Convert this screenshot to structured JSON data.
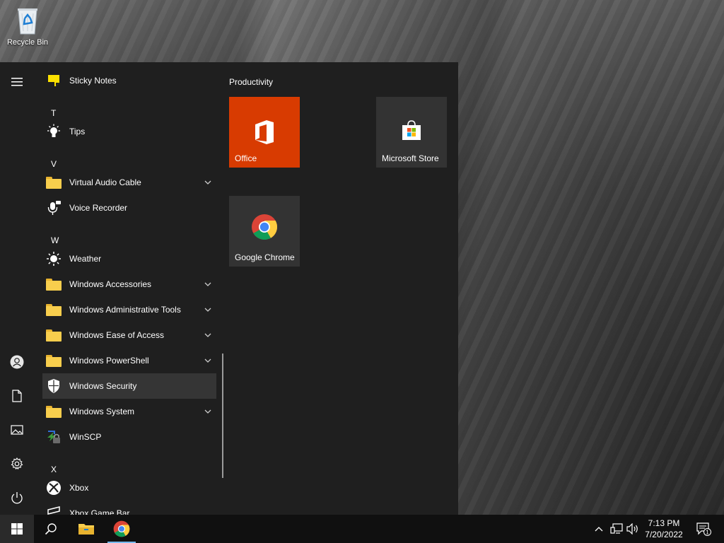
{
  "desktop": {
    "icons": [
      {
        "label": "Recycle Bin",
        "icon": "recycle-bin-icon"
      }
    ]
  },
  "start_menu": {
    "rail": [
      {
        "name": "hamburger-menu",
        "icon": "menu-icon"
      },
      {
        "name": "user-account",
        "icon": "user-icon"
      },
      {
        "name": "documents",
        "icon": "document-icon"
      },
      {
        "name": "pictures",
        "icon": "picture-icon"
      },
      {
        "name": "settings",
        "icon": "gear-icon"
      },
      {
        "name": "power",
        "icon": "power-icon"
      }
    ],
    "app_list": {
      "items": [
        {
          "type": "app",
          "label": "Sticky Notes",
          "icon": "sticky-notes-icon"
        },
        {
          "type": "letter",
          "label": "T"
        },
        {
          "type": "app",
          "label": "Tips",
          "icon": "tips-lightbulb-icon"
        },
        {
          "type": "letter",
          "label": "V"
        },
        {
          "type": "folder",
          "label": "Virtual Audio Cable",
          "icon": "folder-icon",
          "expandable": true
        },
        {
          "type": "app",
          "label": "Voice Recorder",
          "icon": "microphone-icon"
        },
        {
          "type": "letter",
          "label": "W"
        },
        {
          "type": "app",
          "label": "Weather",
          "icon": "weather-sun-icon"
        },
        {
          "type": "folder",
          "label": "Windows Accessories",
          "icon": "folder-icon",
          "expandable": true
        },
        {
          "type": "folder",
          "label": "Windows Administrative Tools",
          "icon": "folder-icon",
          "expandable": true
        },
        {
          "type": "folder",
          "label": "Windows Ease of Access",
          "icon": "folder-icon",
          "expandable": true
        },
        {
          "type": "folder",
          "label": "Windows PowerShell",
          "icon": "folder-icon",
          "expandable": true
        },
        {
          "type": "app",
          "label": "Windows Security",
          "icon": "shield-icon",
          "selected": true
        },
        {
          "type": "folder",
          "label": "Windows System",
          "icon": "folder-icon",
          "expandable": true
        },
        {
          "type": "app",
          "label": "WinSCP",
          "icon": "winscp-icon"
        },
        {
          "type": "letter",
          "label": "X"
        },
        {
          "type": "app",
          "label": "Xbox",
          "icon": "xbox-icon"
        },
        {
          "type": "app",
          "label": "Xbox Game Bar",
          "icon": "xbox-game-bar-icon"
        }
      ]
    },
    "tiles": {
      "group_title": "Productivity",
      "items": [
        {
          "label": "Office",
          "icon": "office-icon",
          "color": "#d83b01"
        },
        {
          "label": "Microsoft Store",
          "icon": "store-bag-icon",
          "color": "#333333"
        },
        {
          "label": "Google Chrome",
          "icon": "chrome-icon",
          "color": "#333333"
        }
      ]
    }
  },
  "taskbar": {
    "buttons": [
      {
        "name": "start",
        "icon": "windows-logo-icon"
      },
      {
        "name": "search",
        "icon": "search-icon"
      },
      {
        "name": "file-explorer",
        "icon": "folder-icon"
      },
      {
        "name": "chrome",
        "icon": "chrome-icon"
      }
    ],
    "tray": {
      "icons": [
        "chevron-up-icon",
        "network-icon",
        "volume-icon"
      ],
      "time": "7:13 PM",
      "date": "7/20/2022",
      "notification_count": "1"
    }
  },
  "colors": {
    "start_bg": "#1f1f1f",
    "selected_bg": "#353535",
    "office_tile": "#d83b01",
    "neutral_tile": "#333333",
    "taskbar_bg": "#101010",
    "folder_yellow": "#f8ce4d"
  }
}
